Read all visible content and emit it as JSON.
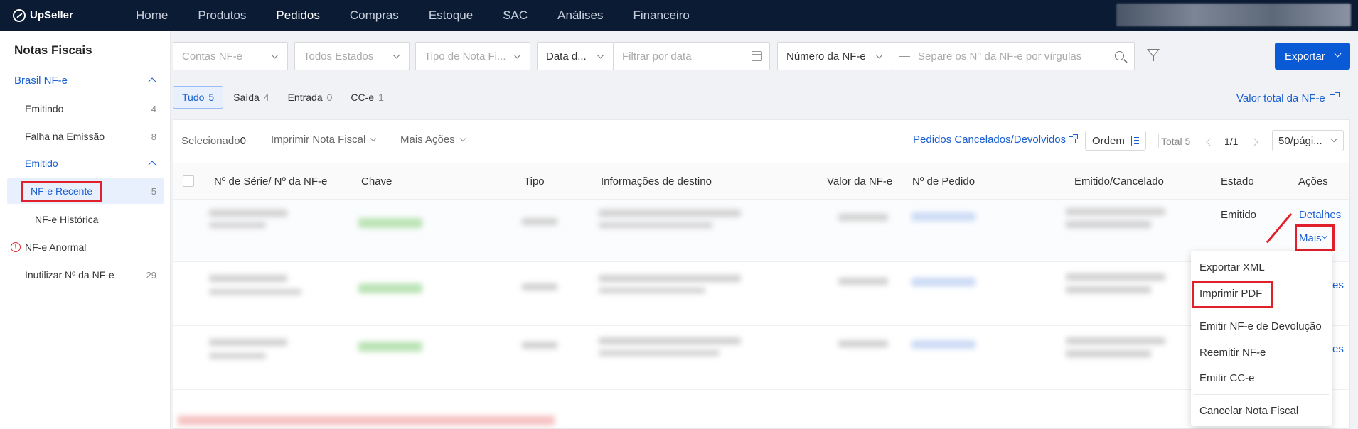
{
  "app": {
    "name": "UpSeller"
  },
  "nav": {
    "items": [
      "Home",
      "Produtos",
      "Pedidos",
      "Compras",
      "Estoque",
      "SAC",
      "Análises",
      "Financeiro"
    ],
    "active": "Pedidos"
  },
  "sidebar": {
    "title": "Notas Fiscais",
    "group_brasil": "Brasil NF-e",
    "emitindo": {
      "label": "Emitindo",
      "count": "4"
    },
    "falha": {
      "label": "Falha na Emissão",
      "count": "8"
    },
    "emitido": "Emitido",
    "recente": {
      "label": "NF-e Recente",
      "count": "5"
    },
    "historica": "NF-e Histórica",
    "anormal": "NF-e Anormal",
    "inutilizar": {
      "label": "Inutilizar Nº da NF-e",
      "count": "29"
    }
  },
  "filters": {
    "contas": "Contas NF-e",
    "estados": "Todos Estados",
    "tipo_nota": "Tipo de Nota Fi...",
    "data": "Data d...",
    "filtrar_data": "Filtrar por data",
    "numero": "Número da NF-e",
    "search_placeholder": "Separe os N° da NF-e por vírgulas",
    "export": "Exportar"
  },
  "tabs": [
    {
      "label": "Tudo",
      "count": "5"
    },
    {
      "label": "Saída",
      "count": "4"
    },
    {
      "label": "Entrada",
      "count": "0"
    },
    {
      "label": "CC-e",
      "count": "1"
    }
  ],
  "valor_total_link": "Valor total da NF-e",
  "toolbar": {
    "selecionado": "Selecionado",
    "selecionado_count": "0",
    "imprimir": "Imprimir Nota Fiscal",
    "mais_acoes": "Mais Ações",
    "cancelados": "Pedidos Cancelados/Devolvidos",
    "ordem": "Ordem",
    "total": "Total 5",
    "page": "1/1",
    "pagesize": "50/pági..."
  },
  "table": {
    "headers": {
      "serie": "Nº de Série/ Nº da NF-e",
      "chave": "Chave",
      "tipo": "Tipo",
      "destino": "Informações de destino",
      "valor": "Valor da NF-e",
      "pedido": "Nº de Pedido",
      "emitido": "Emitido/Cancelado",
      "estado": "Estado",
      "acoes": "Ações"
    },
    "rows": [
      {
        "estado": "Emitido",
        "detalhes": "Detalhes",
        "mais": "Mais"
      },
      {
        "partial_link": "es"
      },
      {
        "partial_link": "es"
      }
    ]
  },
  "menu": {
    "items": [
      "Exportar XML",
      "Imprimir PDF",
      "Emitir NF-e de Devolução",
      "Reemitir NF-e",
      "Emitir CC-e",
      "Cancelar Nota Fiscal"
    ]
  },
  "colors": {
    "topbar": "#0b1b33",
    "accent": "#1a5fd1",
    "export_btn": "#0a5ad6",
    "highlight_red": "#e0202a"
  }
}
